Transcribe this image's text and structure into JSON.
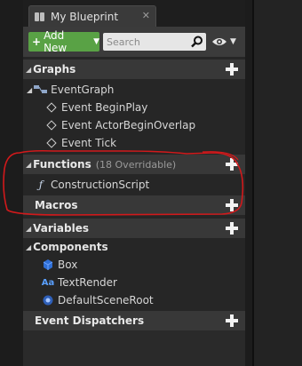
{
  "tab": {
    "title": "My Blueprint",
    "close_glyph": "✕"
  },
  "toolbar": {
    "add_new_label": "Add New",
    "search_placeholder": "Search",
    "search_icon": "magnifier-icon",
    "view_icon": "eye-icon"
  },
  "sections": {
    "graphs": {
      "label": "Graphs"
    },
    "functions": {
      "label": "Functions",
      "subtitle": "(18 Overridable)"
    },
    "macros": {
      "label": "Macros"
    },
    "variables": {
      "label": "Variables"
    },
    "event_dispatchers": {
      "label": "Event Dispatchers"
    }
  },
  "graphs": {
    "event_graph": "EventGraph",
    "events": [
      "Event BeginPlay",
      "Event ActorBeginOverlap",
      "Event Tick"
    ]
  },
  "functions": {
    "items": [
      "ConstructionScript"
    ]
  },
  "variables": {
    "components_label": "Components",
    "components": [
      "Box",
      "TextRender",
      "DefaultSceneRoot"
    ]
  },
  "colors": {
    "accent_green": "#59a245",
    "annotation_red": "#d2191b",
    "section_bg": "#383838"
  }
}
